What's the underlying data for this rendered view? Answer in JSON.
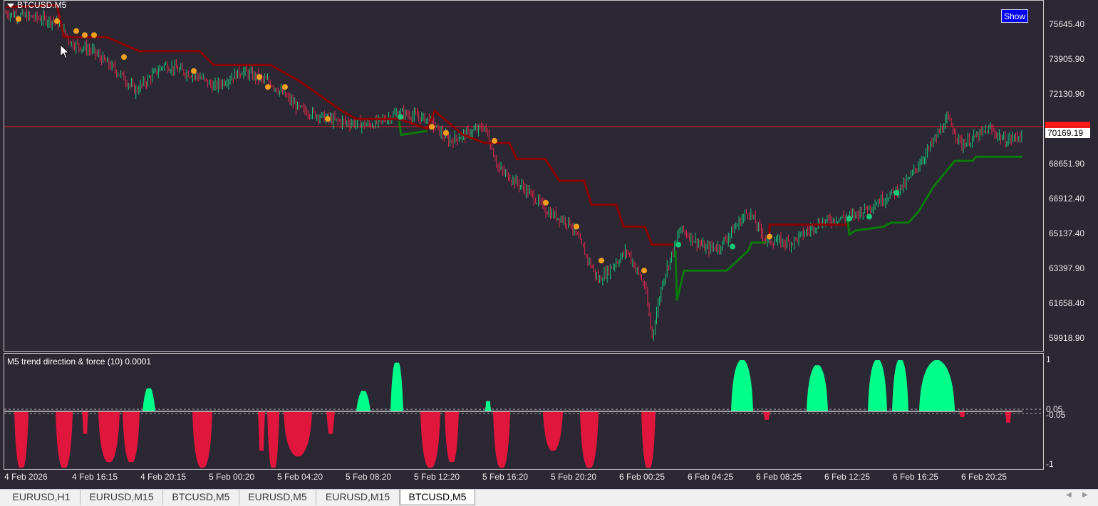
{
  "chart": {
    "symbol": "BTCUSD.M5",
    "show_button": "Show",
    "current_price_red": "70491.91",
    "current_price_bid": "70169.19",
    "price_axis": [
      "75645.40",
      "73905.90",
      "72130.90",
      "70391.90",
      "68651.90",
      "66912.40",
      "65137.40",
      "63397.90",
      "61658.40",
      "59918.90"
    ],
    "time_axis": [
      "4 Feb 2026",
      "4 Feb 16:15",
      "4 Feb 20:15",
      "5 Feb 00:20",
      "5 Feb 04:20",
      "5 Feb 08:20",
      "5 Feb 12:20",
      "5 Feb 16:20",
      "5 Feb 20:20",
      "6 Feb 00:25",
      "6 Feb 04:25",
      "6 Feb 08:25",
      "6 Feb 12:25",
      "6 Feb 16:25",
      "6 Feb 20:25"
    ],
    "colors": {
      "background": "#2b2733",
      "bull_candle": "#19c77a",
      "bear_candle": "#e0284c",
      "stop_down": "#8b0000",
      "stop_up": "#0a7a0a",
      "bid_line": "#d42020",
      "signal_dot": "#f4a01c",
      "ind_positive": "#00ff8a",
      "ind_negative": "#e0163c"
    }
  },
  "indicator": {
    "title": "M5 trend direction & force (10) 0.0001",
    "axis": {
      "top": "1",
      "upper_level": "0.05",
      "lower_level": "-0.05",
      "bottom": "-1"
    }
  },
  "tabs": [
    "EURUSD,H1",
    "EURUSD,M15",
    "BTCUSD,M5",
    "EURUSD,M5",
    "EURUSD,M15",
    "BTCUSD,M5"
  ],
  "active_tab_index": 5
}
